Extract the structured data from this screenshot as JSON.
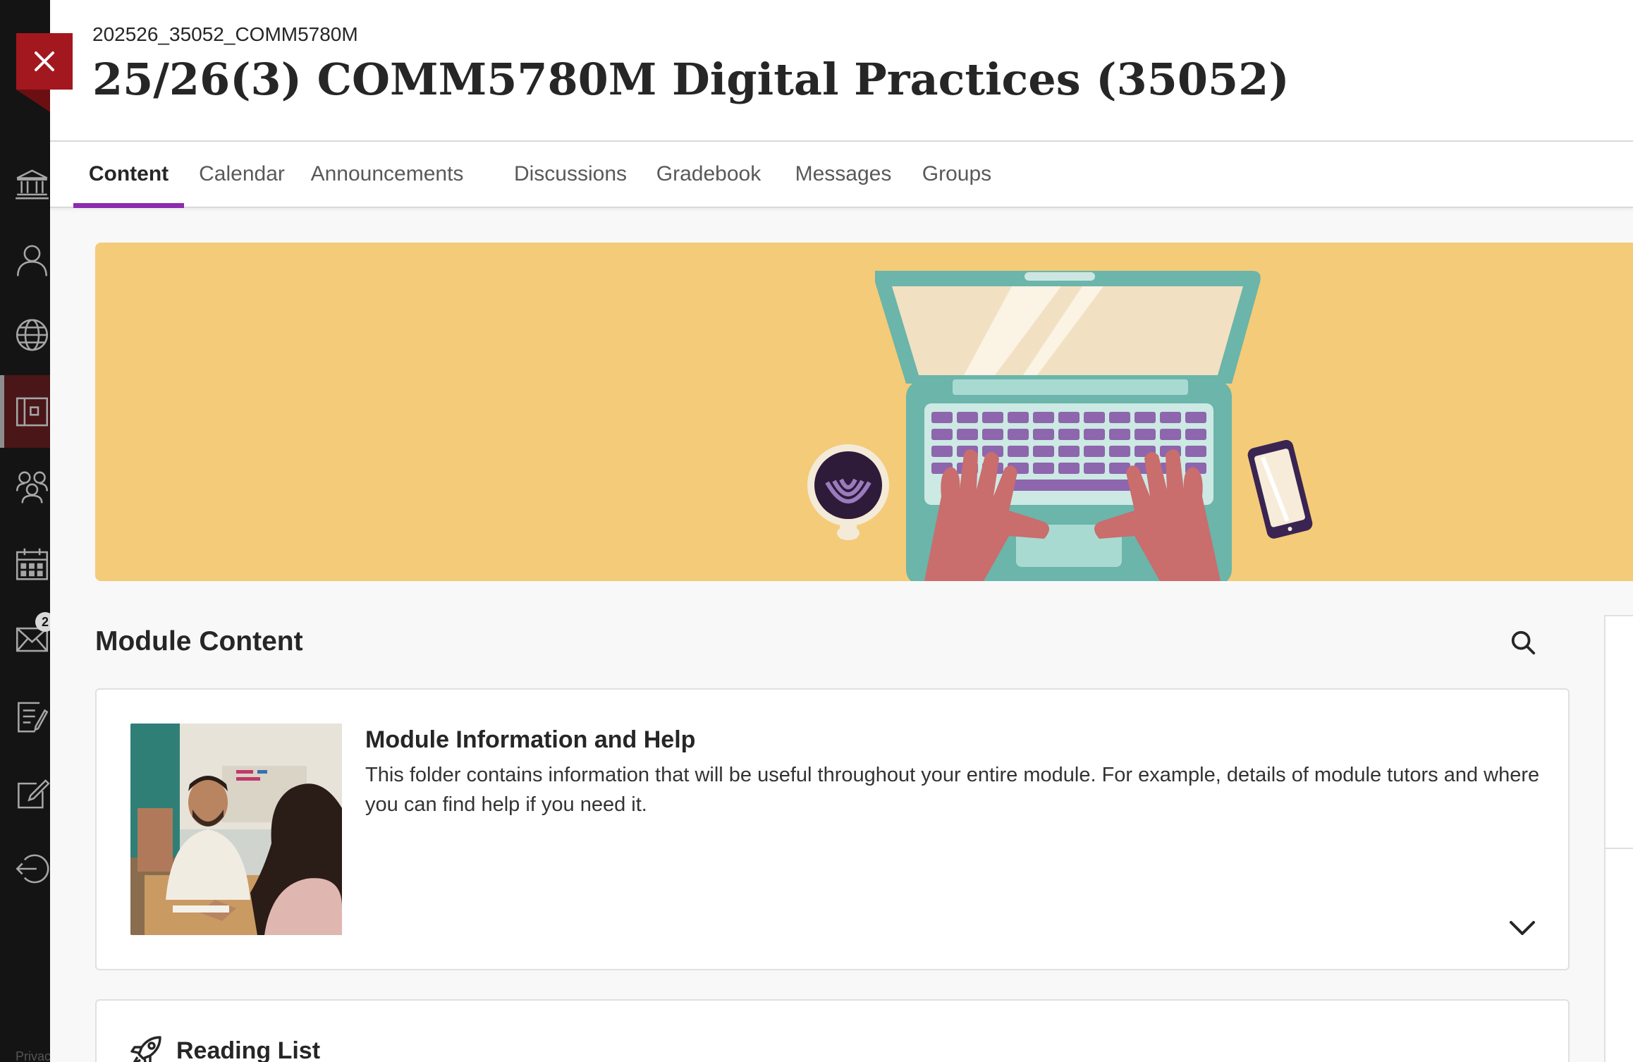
{
  "course": {
    "code": "202526_35052_COMM5780M",
    "title": "25/26(3) COMM5780M Digital Practices (35052)"
  },
  "tabs": [
    {
      "label": "Content",
      "active": true
    },
    {
      "label": "Calendar",
      "active": false
    },
    {
      "label": "Announcements",
      "active": false
    },
    {
      "label": "Discussions",
      "active": false
    },
    {
      "label": "Gradebook",
      "active": false
    },
    {
      "label": "Messages",
      "active": false
    },
    {
      "label": "Groups",
      "active": false
    }
  ],
  "sidebar": {
    "items": [
      {
        "icon": "institution-icon"
      },
      {
        "icon": "profile-icon"
      },
      {
        "icon": "globe-icon"
      },
      {
        "icon": "courses-icon",
        "active": true
      },
      {
        "icon": "organizations-icon"
      },
      {
        "icon": "calendar-icon"
      },
      {
        "icon": "messages-icon"
      },
      {
        "icon": "grades-icon"
      },
      {
        "icon": "tools-icon"
      },
      {
        "icon": "sign-out-icon"
      }
    ],
    "messages_badge": "2",
    "footer": "Privacy"
  },
  "module_content": {
    "heading": "Module Content",
    "items": [
      {
        "title": "Module Information and Help",
        "description": "This folder contains information that will be useful throughout your entire module. For example, details of module tutors and where you can find help if you need it."
      },
      {
        "title": "Reading List"
      }
    ]
  },
  "colors": {
    "accent_tab": "#8c2bb0",
    "close_button": "#a3171e",
    "sidebar": "#141414",
    "banner": "#f4cb78"
  }
}
